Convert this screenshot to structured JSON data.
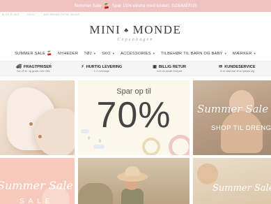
{
  "promo": {
    "text_before": "Summer Sale",
    "text_after": "Spar 15% ekstra med koden: SOMMER15",
    "cherry_icon": "🍒"
  },
  "utility_links": [
    "BLOG PLADS",
    "NIVOL",
    "MINI MONDE RETAIL BAZAR"
  ],
  "logo": {
    "name_left": "MINI",
    "name_right": "MONDE",
    "tagline": "Copenhagen"
  },
  "nav": [
    {
      "label": "SUMMER SALE",
      "cherry": "🍒",
      "chevron": false
    },
    {
      "label": "NYHEDER",
      "chevron": false
    },
    {
      "label": "TØJ",
      "chevron": true
    },
    {
      "label": "SKO",
      "chevron": true
    },
    {
      "label": "ACCESSORIES",
      "chevron": true
    },
    {
      "label": "TILBEHØR TIL BARN OG BABY",
      "chevron": true
    },
    {
      "label": "MÆRKER",
      "chevron": true
    }
  ],
  "usps": [
    {
      "icon": "truck-icon",
      "title": "FRAGTPRISER",
      "subtitle": "Fra 25 kr. og gratis over 399,-"
    },
    {
      "icon": "lightning-icon",
      "title": "HURTIG LEVERING",
      "subtitle": "1-3 hverdage"
    },
    {
      "icon": "box-icon",
      "title": "BILLIG RETUR",
      "subtitle": "hvis du skulle fortryde"
    },
    {
      "icon": "chat-icon",
      "title": "KUNDESERVICE",
      "subtitle": "Vi er altid klar til at hjælpe dig"
    }
  ],
  "tiles": {
    "discount": {
      "label": "Spar op til",
      "value": "70%"
    },
    "sale_right": {
      "title": "Summer Sale",
      "cta": "SHOP TIL DRENG"
    },
    "sale_left": {
      "title": "Summer Sale",
      "subtitle": "SALE"
    },
    "sale_bottom_right": {
      "title": "Summer Sale"
    }
  },
  "colors": {
    "promo_bg": "#eec3c0",
    "cherry": "#c8232b",
    "usp_bg": "#f5f5f5"
  }
}
